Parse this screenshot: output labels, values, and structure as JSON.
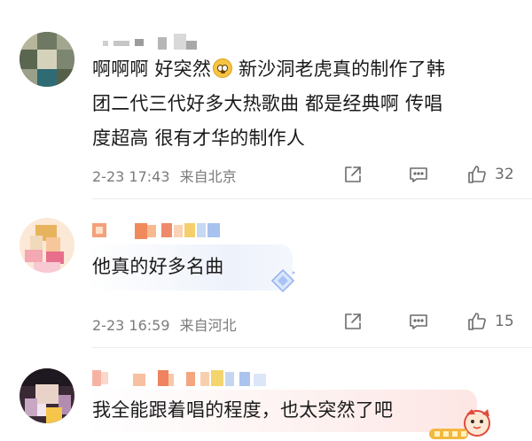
{
  "comments": [
    {
      "text": "啊啊啊 好突然",
      "text_after_emoji": " 新沙洞老虎真的制作了韩团二代三代好多大热歌曲 都是经典啊 传唱度超高 很有才华的制作人",
      "line1": "啊啊啊 好突然",
      "line1b": " 新沙洞老虎真的制作了韩",
      "line2": "团二代三代好多大热歌曲 都是经典啊 传唱",
      "line3": "度超高 很有才华的制作人",
      "date": "2-23 17:43",
      "location": "来自北京",
      "likes": "32"
    },
    {
      "text": "他真的好多名曲",
      "date": "2-23 16:59",
      "location": "来自河北",
      "likes": "15"
    },
    {
      "text": "我全能跟着唱的程度，也太突然了吧"
    }
  ],
  "icons": {
    "share": "share-icon",
    "reply": "comment-icon",
    "like": "thumb-up-icon",
    "emoji": "thinking-emoji-icon"
  },
  "colors": {
    "text": "#1a1a1a",
    "meta": "#7b7b7b",
    "icon": "#6b6b6b",
    "bubble": "#eef2fb"
  }
}
